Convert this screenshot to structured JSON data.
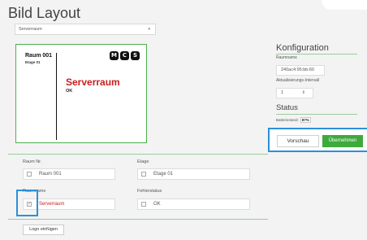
{
  "page": {
    "title": "Bild Layout"
  },
  "layout_select": {
    "value": "Serverraum"
  },
  "preview": {
    "room_number": "Raum 001",
    "floor": "Etage 01",
    "badges": [
      "M",
      "C",
      "S"
    ],
    "room_name": "Serverraum",
    "status": "OK",
    "colors": {
      "room_name": "#c81e1e",
      "border": "#4caf50"
    }
  },
  "config": {
    "title": "Konfiguration",
    "room_name_label": "Raumname",
    "room_name_value": "240ac4:95:bb:60",
    "interval_label": "Aktualisierungs-Intervall",
    "interval_value": "1",
    "status_title": "Status",
    "battery_label": "Batteriestand:",
    "battery_value": "87%",
    "preview_button": "Vorschau",
    "apply_button": "Übernehmen",
    "colors": {
      "apply": "#3daa3b",
      "highlight": "#2b90d9"
    }
  },
  "form": {
    "room_no_label": "Raum Nr.",
    "room_no_value": "Raum 001",
    "floor_label": "Etage",
    "floor_value": "Etage 01",
    "room_name_label": "Raumname",
    "room_name_value": "Serverraum",
    "error_label": "Fehlerstatus",
    "error_value": "OK",
    "room_name_checked": true
  },
  "logo_button": "Logo einfügen"
}
